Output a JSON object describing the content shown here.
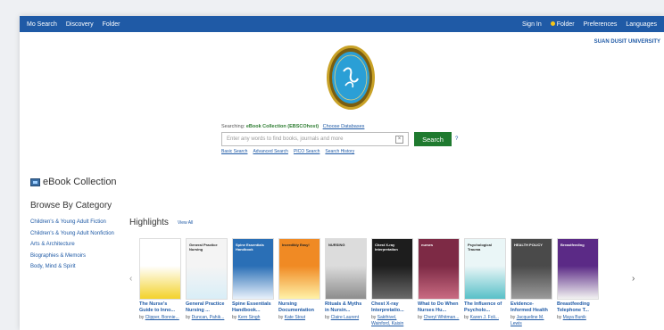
{
  "topbar": {
    "left_items": [
      "Mo Search",
      "Discovery",
      "Folder"
    ],
    "right_items": [
      "Sign In",
      "Folder",
      "Preferences",
      "Languages"
    ]
  },
  "university": "SUAN DUSIT UNIVERSITY",
  "search": {
    "searching_label": "Searching:",
    "collection": "eBook Collection (EBSCOhost)",
    "choose_db": "Choose Databases",
    "placeholder": "Enter any words to find books, journals and more",
    "button": "Search",
    "help": "?",
    "links": [
      "Basic Search",
      "Advanced Search",
      "PICO Search",
      "Search History"
    ]
  },
  "collection_title": "eBook Collection",
  "browse": {
    "title": "Browse By Category",
    "categories": [
      "Children's & Young Adult Fiction",
      "Children's & Young Adult Nonfiction",
      "Arts & Architecture",
      "Biographies & Memoirs",
      "Body, Mind & Spirit"
    ]
  },
  "highlights": {
    "title": "Highlights",
    "view_all": "View All"
  },
  "books": [
    {
      "title": "The Nurse's Guide to Inno...",
      "by": "by",
      "author": "Clipper, Bonnie...",
      "colors": [
        "#ffffff",
        "#f3d22b"
      ],
      "cover_text": ""
    },
    {
      "title": "General Practice Nursing ...",
      "by": "by",
      "author": "Duncan, Pahik...",
      "colors": [
        "#f4f4f4",
        "#d9eef7"
      ],
      "cover_text": "General Practice Nursing"
    },
    {
      "title": "Spine Essentials Handbook...",
      "by": "by",
      "author": "Kern Singh",
      "colors": [
        "#2a6fb6",
        "#e8f1fb"
      ],
      "cover_text": "Spine Essentials Handbook"
    },
    {
      "title": "Nursing Documentation Mad...",
      "by": "by",
      "author": "Kate Stout",
      "colors": [
        "#f08a24",
        "#fff2a8"
      ],
      "cover_text": "Incredibly Easy!"
    },
    {
      "title": "Rituals & Myths in Nursin...",
      "by": "by",
      "author": "Claire Laurent",
      "colors": [
        "#dcdcdc",
        "#8d8d8d"
      ],
      "cover_text": "NURSING"
    },
    {
      "title": "Chest X-ray Interpretatio...",
      "by": "by",
      "author": "Sakthivel, Wainford, Kaisin",
      "colors": [
        "#1d1d1d",
        "#6a6a6a"
      ],
      "cover_text": "Chest X-ray Interpretation"
    },
    {
      "title": "What to Do When Nurses Hu...",
      "by": "by",
      "author": "Cheryl Whitman...",
      "colors": [
        "#7d2a45",
        "#c96b82"
      ],
      "cover_text": "nurses"
    },
    {
      "title": "The Influence of Psycholo...",
      "by": "by",
      "author": "Karen J. Foli...",
      "colors": [
        "#eaf6f7",
        "#58c0c8"
      ],
      "cover_text": "Psychological Trauma"
    },
    {
      "title": "Evidence-Informed Health ...",
      "by": "by",
      "author": "Jacqueline M. Lewis",
      "colors": [
        "#4a4a4a",
        "#9b9b9b"
      ],
      "cover_text": "HEALTH POLICY"
    },
    {
      "title": "Breastfeeding Telephone T...",
      "by": "by",
      "author": "Maya Bunik",
      "colors": [
        "#5b2a86",
        "#f2f2f2"
      ],
      "cover_text": "Breastfeeding"
    }
  ],
  "colors": {
    "brand_blue": "#1f5aa6",
    "search_green": "#1f7a2f",
    "collection_green": "#2e7d32"
  }
}
